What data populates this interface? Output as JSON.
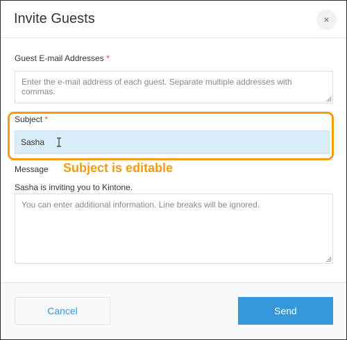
{
  "dialog": {
    "title": "Invite Guests",
    "close_symbol": "×",
    "close_icon": "close-icon"
  },
  "guest_emails": {
    "label": "Guest E-mail Addresses",
    "required_marker": "*",
    "placeholder": "Enter the e-mail address of each guest. Separate multiple addresses with commas."
  },
  "subject": {
    "label": "Subject",
    "required_marker": "*",
    "value": "Sasha",
    "cursor_icon": "text-cursor-icon"
  },
  "annotation": {
    "text": "Subject is editable",
    "color": "#f39c12"
  },
  "message": {
    "label": "Message",
    "default_text": "Sasha is inviting you to Kintone.",
    "placeholder": "You can enter additional information. Line breaks will be ignored."
  },
  "footer": {
    "cancel_label": "Cancel",
    "send_label": "Send"
  },
  "colors": {
    "accent": "#3498db",
    "required": "#e74c3c",
    "subject_background": "#d9ecfa",
    "highlight": "#f39c12"
  }
}
